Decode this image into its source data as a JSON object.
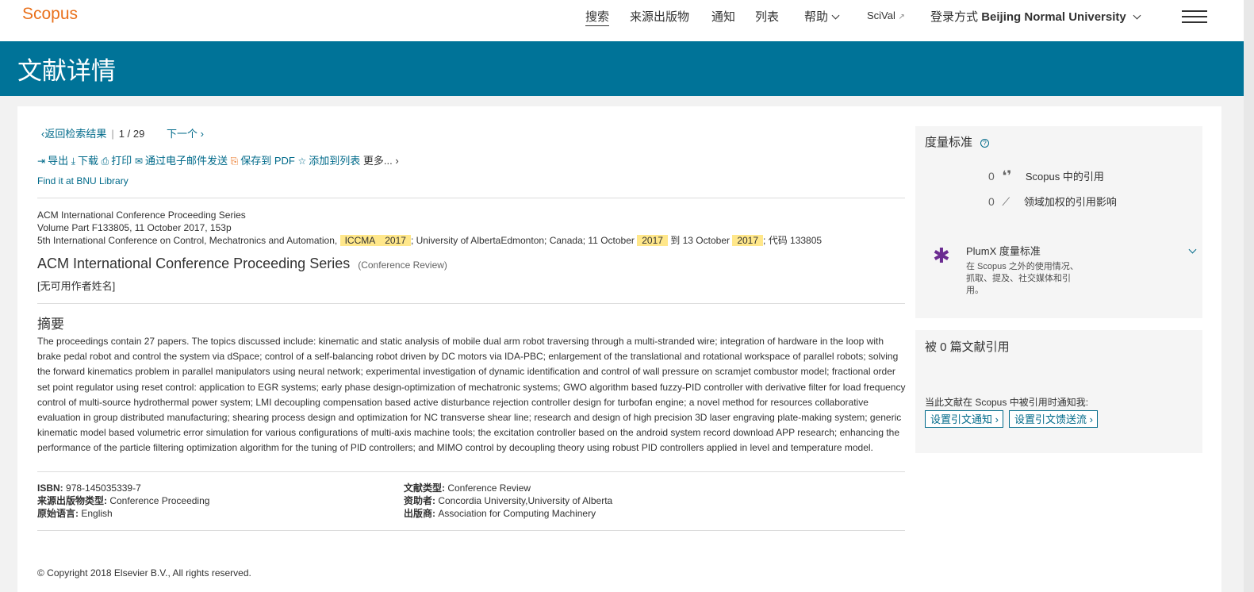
{
  "header": {
    "logo": "Scopus",
    "nav": {
      "search": "搜索",
      "sources": "来源出版物",
      "alerts": "通知",
      "lists": "列表",
      "help": "帮助",
      "scival": "SciVal",
      "login_prefix": "登录方式",
      "institution": "Beijing Normal University"
    }
  },
  "banner": {
    "title": "文献详情"
  },
  "pager": {
    "back": "返回检索结果",
    "current": "1",
    "separator": "/",
    "total": "29",
    "next": "下一个"
  },
  "toolbar": {
    "export": "导出",
    "download": "下载",
    "print": "打印",
    "email": "通过电子邮件发送",
    "save_pdf": "保存到 PDF",
    "add_list": "添加到列表",
    "more": "更多...",
    "find_it": "Find it at BNU Library"
  },
  "meta": {
    "series": "ACM International Conference Proceeding Series",
    "volume": "Volume Part F133805, 11 October 2017, 153p",
    "conf_prefix": "5th International Conference on Control, Mechatronics and Automation,",
    "hl_iccma": "ICCMA",
    "hl_year1": "2017",
    "conf_mid": "; University of AlbertaEdmonton; Canada; 11 October",
    "hl_year2": "2017",
    "conf_to": "到 13 October",
    "hl_year3": "2017",
    "conf_code": "; 代码 133805"
  },
  "source": {
    "title": "ACM International Conference Proceeding Series",
    "type": "(Conference Review)",
    "authors": "[无可用作者姓名]"
  },
  "abstract": {
    "heading": "摘要",
    "text": "The proceedings contain 27 papers. The topics discussed include: kinematic and static analysis of mobile dual arm robot traversing through a multi-stranded wire; integration of hardware in the loop with brake pedal robot and control the system via dSpace; control of a self-balancing robot driven by DC motors via IDA-PBC; enlargement of the translational and rotational workspace of parallel robots; solving the forward kinematics problem in parallel manipulators using neural network; experimental investigation of dynamic identification and control of wall pressure on scramjet combustor model; fractional order set point regulator using reset control: application to EGR systems; early phase design-optimization of mechatronic systems; GWO algorithm based fuzzy-PID controller with derivative filter for load frequency control of multi-source hydrothermal power system; LMI decoupling compensation based active disturbance rejection controller design for turbofan engine; a novel method for resources collaborative evaluation in group distributed manufacturing; shearing process design and optimization for NC transverse shear line; research and design of high precision 3D laser engraving plate-making system; generic kinematic model based volumetric error simulation for various configurations of multi-axis machine tools; the excitation controller based on the android system record download APP research; enhancing the performance of the particle filtering optimization algorithm for the tuning of PID controllers; and MIMO control by decoupling theory using robust PID controllers applied in level and temperature model."
  },
  "details": {
    "isbn_label": "ISBN:",
    "isbn": "978-145035339-7",
    "source_type_label": "来源出版物类型:",
    "source_type": "Conference Proceeding",
    "language_label": "原始语言:",
    "language": "English",
    "doc_type_label": "文献类型:",
    "doc_type": "Conference Review",
    "sponsors_label": "资助者:",
    "sponsors": "Concordia University,University of Alberta",
    "publisher_label": "出版商:",
    "publisher": "Association for Computing Machinery"
  },
  "copyright": "© Copyright 2018 Elsevier B.V., All rights reserved.",
  "metrics": {
    "title": "度量标准",
    "citations_count": "0",
    "citations_label": "Scopus 中的引用",
    "fwci_count": "0",
    "fwci_label": "领域加权的引用影响",
    "plumx_title": "PlumX 度量标准",
    "plumx_line1": "在 Scopus 之外的使用情况、",
    "plumx_line2": "抓取、提及、社交媒体和引",
    "plumx_line3": "用。"
  },
  "cited_by": {
    "title": "被 0 篇文献引用",
    "notify_text": "当此文献在 Scopus 中被引用时通知我:",
    "alert_button": "设置引文通知",
    "feed_button": "设置引文馈送流"
  },
  "colors": {
    "brand_orange": "#e9711c",
    "banner_blue": "#007398",
    "link": "#006a8a",
    "highlight": "#ffe78a",
    "plumx_purple": "#6b2c91"
  }
}
